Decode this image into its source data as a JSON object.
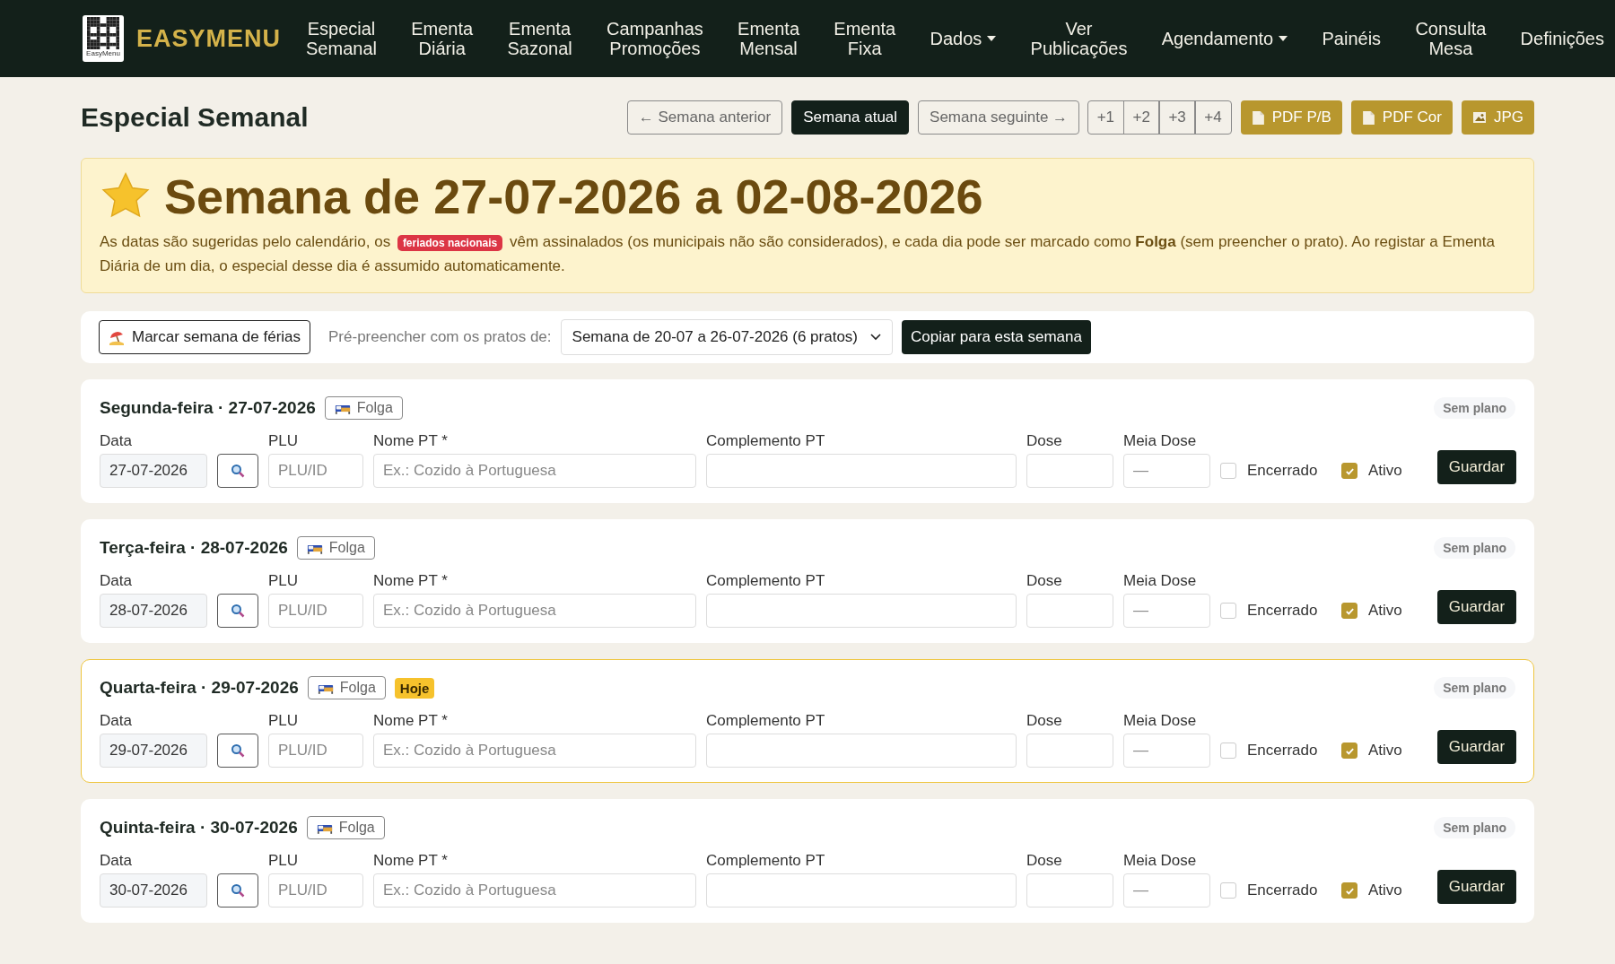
{
  "navbar": {
    "brand": "EASYMENU",
    "logo_caption": "EasyMenu",
    "items": [
      {
        "label": "Especial Semanal",
        "has_menu": false
      },
      {
        "label": "Ementa Diária",
        "has_menu": false
      },
      {
        "label": "Ementa Sazonal",
        "has_menu": false
      },
      {
        "label": "Campanhas Promoções",
        "has_menu": false
      },
      {
        "label": "Ementa Mensal",
        "has_menu": false
      },
      {
        "label": "Ementa Fixa",
        "has_menu": false
      },
      {
        "label": "Dados",
        "has_menu": true
      },
      {
        "label": "Ver Publicações",
        "has_menu": false
      },
      {
        "label": "Agendamento",
        "has_menu": true
      },
      {
        "label": "Painéis",
        "has_menu": false
      },
      {
        "label": "Consulta Mesa",
        "has_menu": false
      },
      {
        "label": "Definições",
        "has_menu": false
      }
    ]
  },
  "page_title": "Especial Semanal",
  "week_nav": [
    {
      "label": "← Semana anterior",
      "selected": false
    },
    {
      "label": "Semana atual",
      "selected": true
    },
    {
      "label": "Semana seguinte →",
      "selected": false
    }
  ],
  "week_offsets": [
    "+1",
    "+2",
    "+3",
    "+4"
  ],
  "exports": [
    {
      "label": "PDF P/B",
      "kind": "pdf"
    },
    {
      "label": "PDF Cor",
      "kind": "pdf"
    },
    {
      "label": "JPG",
      "kind": "image"
    }
  ],
  "banner": {
    "heading": "Semana de 27-07-2026 a 02-08-2026",
    "text_before": "As datas são sugeridas pelo calendário, os",
    "badge": "feriados nacionais",
    "text_after": "vêm assinalados (os municipais não são considerados), e cada dia pode ser marcado como **Folga** (sem preencher o prato). Ao registar a Ementa Diária de um dia, o especial desse dia é assumido automaticamente."
  },
  "toolbar": {
    "vacation_button": "Marcar semana de férias",
    "prefill_label": "Pré-preencher com os pratos de:",
    "prefill_value": "Semana de 20-07 a 26-07-2026 (6 pratos)",
    "copy_button": "Copiar para esta semana"
  },
  "days": [
    {
      "title": "Segunda-feira · 27-07-2026",
      "folga": "Folga",
      "today": false,
      "status": "Sem plano",
      "labels": [
        "Data",
        "PLU",
        "Nome PT *",
        "Complemento PT",
        "Dose",
        "Meia Dose"
      ],
      "date": "27-07-2026",
      "plu_placeholder": "PLU/ID",
      "name_placeholder": "Ex.: Cozido à Portuguesa",
      "half_dose_placeholder": "—",
      "closed_label": "Encerrado",
      "closed": false,
      "active_label": "Ativo",
      "active": true,
      "save": "Guardar"
    },
    {
      "title": "Terça-feira · 28-07-2026",
      "folga": "Folga",
      "today": false,
      "status": "Sem plano",
      "labels": [
        "Data",
        "PLU",
        "Nome PT *",
        "Complemento PT",
        "Dose",
        "Meia Dose"
      ],
      "date": "28-07-2026",
      "plu_placeholder": "PLU/ID",
      "name_placeholder": "Ex.: Cozido à Portuguesa",
      "half_dose_placeholder": "—",
      "closed_label": "Encerrado",
      "closed": false,
      "active_label": "Ativo",
      "active": true,
      "save": "Guardar"
    },
    {
      "title": "Quarta-feira · 29-07-2026",
      "folga": "Folga",
      "today": true,
      "today_badge": "Hoje",
      "status": "Sem plano",
      "labels": [
        "Data",
        "PLU",
        "Nome PT *",
        "Complemento PT",
        "Dose",
        "Meia Dose"
      ],
      "date": "29-07-2026",
      "plu_placeholder": "PLU/ID",
      "name_placeholder": "Ex.: Cozido à Portuguesa",
      "half_dose_placeholder": "—",
      "closed_label": "Encerrado",
      "closed": false,
      "active_label": "Ativo",
      "active": true,
      "save": "Guardar"
    },
    {
      "title": "Quinta-feira · 30-07-2026",
      "folga": "Folga",
      "today": false,
      "status": "Sem plano",
      "labels": [
        "Data",
        "PLU",
        "Nome PT *",
        "Complemento PT",
        "Dose",
        "Meia Dose"
      ],
      "date": "30-07-2026",
      "plu_placeholder": "PLU/ID",
      "name_placeholder": "Ex.: Cozido à Portuguesa",
      "half_dose_placeholder": "—",
      "closed_label": "Encerrado",
      "closed": false,
      "active_label": "Ativo",
      "active": true,
      "save": "Guardar"
    }
  ]
}
